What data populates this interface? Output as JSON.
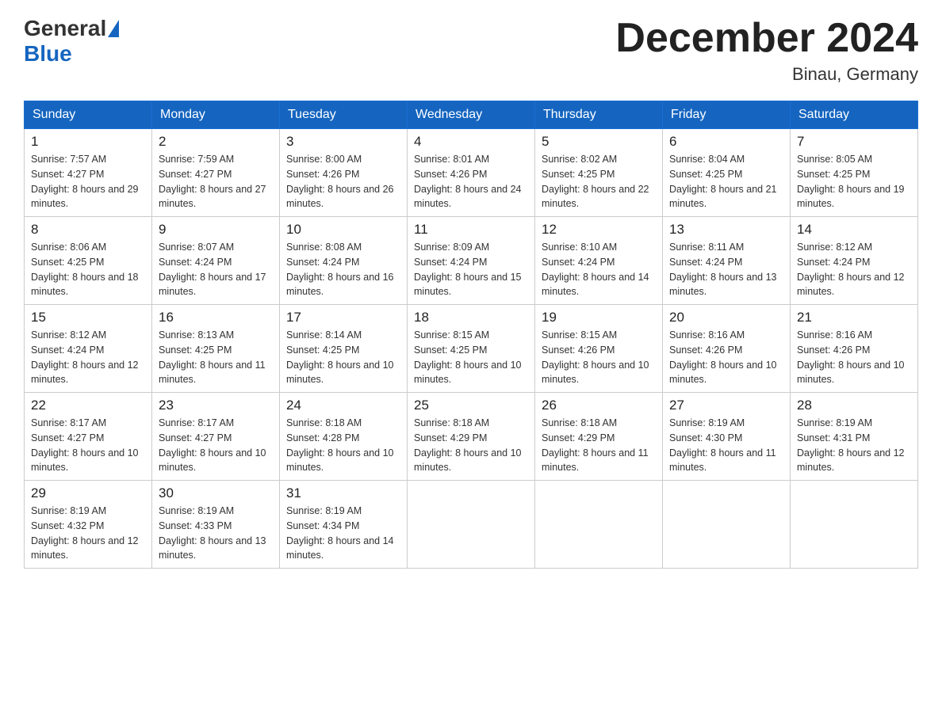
{
  "header": {
    "logo_general": "General",
    "logo_blue": "Blue",
    "month_year": "December 2024",
    "location": "Binau, Germany"
  },
  "days_of_week": [
    "Sunday",
    "Monday",
    "Tuesday",
    "Wednesday",
    "Thursday",
    "Friday",
    "Saturday"
  ],
  "weeks": [
    [
      {
        "day": "1",
        "sunrise": "7:57 AM",
        "sunset": "4:27 PM",
        "daylight": "8 hours and 29 minutes."
      },
      {
        "day": "2",
        "sunrise": "7:59 AM",
        "sunset": "4:27 PM",
        "daylight": "8 hours and 27 minutes."
      },
      {
        "day": "3",
        "sunrise": "8:00 AM",
        "sunset": "4:26 PM",
        "daylight": "8 hours and 26 minutes."
      },
      {
        "day": "4",
        "sunrise": "8:01 AM",
        "sunset": "4:26 PM",
        "daylight": "8 hours and 24 minutes."
      },
      {
        "day": "5",
        "sunrise": "8:02 AM",
        "sunset": "4:25 PM",
        "daylight": "8 hours and 22 minutes."
      },
      {
        "day": "6",
        "sunrise": "8:04 AM",
        "sunset": "4:25 PM",
        "daylight": "8 hours and 21 minutes."
      },
      {
        "day": "7",
        "sunrise": "8:05 AM",
        "sunset": "4:25 PM",
        "daylight": "8 hours and 19 minutes."
      }
    ],
    [
      {
        "day": "8",
        "sunrise": "8:06 AM",
        "sunset": "4:25 PM",
        "daylight": "8 hours and 18 minutes."
      },
      {
        "day": "9",
        "sunrise": "8:07 AM",
        "sunset": "4:24 PM",
        "daylight": "8 hours and 17 minutes."
      },
      {
        "day": "10",
        "sunrise": "8:08 AM",
        "sunset": "4:24 PM",
        "daylight": "8 hours and 16 minutes."
      },
      {
        "day": "11",
        "sunrise": "8:09 AM",
        "sunset": "4:24 PM",
        "daylight": "8 hours and 15 minutes."
      },
      {
        "day": "12",
        "sunrise": "8:10 AM",
        "sunset": "4:24 PM",
        "daylight": "8 hours and 14 minutes."
      },
      {
        "day": "13",
        "sunrise": "8:11 AM",
        "sunset": "4:24 PM",
        "daylight": "8 hours and 13 minutes."
      },
      {
        "day": "14",
        "sunrise": "8:12 AM",
        "sunset": "4:24 PM",
        "daylight": "8 hours and 12 minutes."
      }
    ],
    [
      {
        "day": "15",
        "sunrise": "8:12 AM",
        "sunset": "4:24 PM",
        "daylight": "8 hours and 12 minutes."
      },
      {
        "day": "16",
        "sunrise": "8:13 AM",
        "sunset": "4:25 PM",
        "daylight": "8 hours and 11 minutes."
      },
      {
        "day": "17",
        "sunrise": "8:14 AM",
        "sunset": "4:25 PM",
        "daylight": "8 hours and 10 minutes."
      },
      {
        "day": "18",
        "sunrise": "8:15 AM",
        "sunset": "4:25 PM",
        "daylight": "8 hours and 10 minutes."
      },
      {
        "day": "19",
        "sunrise": "8:15 AM",
        "sunset": "4:26 PM",
        "daylight": "8 hours and 10 minutes."
      },
      {
        "day": "20",
        "sunrise": "8:16 AM",
        "sunset": "4:26 PM",
        "daylight": "8 hours and 10 minutes."
      },
      {
        "day": "21",
        "sunrise": "8:16 AM",
        "sunset": "4:26 PM",
        "daylight": "8 hours and 10 minutes."
      }
    ],
    [
      {
        "day": "22",
        "sunrise": "8:17 AM",
        "sunset": "4:27 PM",
        "daylight": "8 hours and 10 minutes."
      },
      {
        "day": "23",
        "sunrise": "8:17 AM",
        "sunset": "4:27 PM",
        "daylight": "8 hours and 10 minutes."
      },
      {
        "day": "24",
        "sunrise": "8:18 AM",
        "sunset": "4:28 PM",
        "daylight": "8 hours and 10 minutes."
      },
      {
        "day": "25",
        "sunrise": "8:18 AM",
        "sunset": "4:29 PM",
        "daylight": "8 hours and 10 minutes."
      },
      {
        "day": "26",
        "sunrise": "8:18 AM",
        "sunset": "4:29 PM",
        "daylight": "8 hours and 11 minutes."
      },
      {
        "day": "27",
        "sunrise": "8:19 AM",
        "sunset": "4:30 PM",
        "daylight": "8 hours and 11 minutes."
      },
      {
        "day": "28",
        "sunrise": "8:19 AM",
        "sunset": "4:31 PM",
        "daylight": "8 hours and 12 minutes."
      }
    ],
    [
      {
        "day": "29",
        "sunrise": "8:19 AM",
        "sunset": "4:32 PM",
        "daylight": "8 hours and 12 minutes."
      },
      {
        "day": "30",
        "sunrise": "8:19 AM",
        "sunset": "4:33 PM",
        "daylight": "8 hours and 13 minutes."
      },
      {
        "day": "31",
        "sunrise": "8:19 AM",
        "sunset": "4:34 PM",
        "daylight": "8 hours and 14 minutes."
      },
      null,
      null,
      null,
      null
    ]
  ]
}
